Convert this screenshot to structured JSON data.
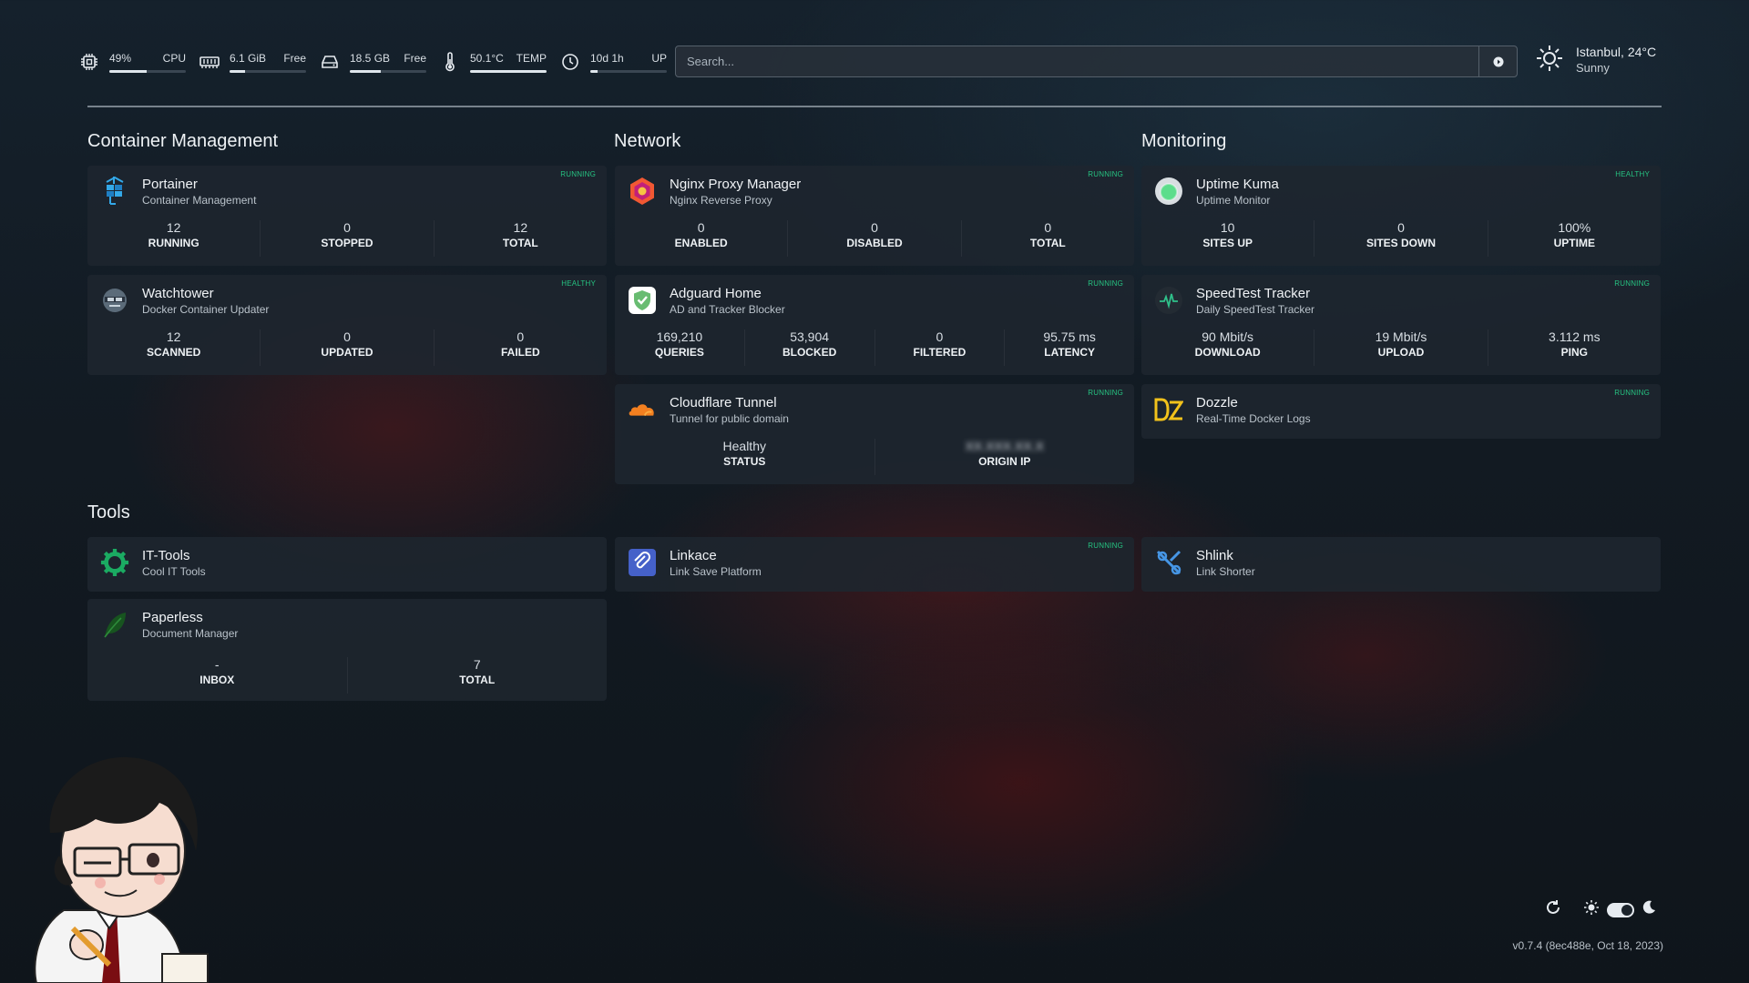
{
  "topbar": {
    "cpu": {
      "value": "49%",
      "label": "CPU",
      "fill": 0.49
    },
    "ram": {
      "value": "6.1 GiB",
      "label": "Free",
      "fill": 0.2
    },
    "disk": {
      "value": "18.5 GB",
      "label": "Free",
      "fill": 0.4
    },
    "temp": {
      "value": "50.1°C",
      "label": "TEMP",
      "fill": 1.0
    },
    "uptime": {
      "value": "10d 1h",
      "label": "UP",
      "fill": 0.1
    },
    "search_placeholder": "Search...",
    "weather": {
      "location": "Istanbul, 24°C",
      "condition": "Sunny"
    }
  },
  "sections": {
    "container": "Container Management",
    "network": "Network",
    "monitoring": "Monitoring",
    "tools": "Tools"
  },
  "cards": {
    "portainer": {
      "title": "Portainer",
      "subtitle": "Container Management",
      "badge": "RUNNING",
      "stats": [
        {
          "value": "12",
          "label": "RUNNING"
        },
        {
          "value": "0",
          "label": "STOPPED"
        },
        {
          "value": "12",
          "label": "TOTAL"
        }
      ]
    },
    "watchtower": {
      "title": "Watchtower",
      "subtitle": "Docker Container Updater",
      "badge": "HEALTHY",
      "stats": [
        {
          "value": "12",
          "label": "SCANNED"
        },
        {
          "value": "0",
          "label": "UPDATED"
        },
        {
          "value": "0",
          "label": "FAILED"
        }
      ]
    },
    "nginx": {
      "title": "Nginx Proxy Manager",
      "subtitle": "Nginx Reverse Proxy",
      "badge": "RUNNING",
      "stats": [
        {
          "value": "0",
          "label": "ENABLED"
        },
        {
          "value": "0",
          "label": "DISABLED"
        },
        {
          "value": "0",
          "label": "TOTAL"
        }
      ]
    },
    "adguard": {
      "title": "Adguard Home",
      "subtitle": "AD and Tracker Blocker",
      "badge": "RUNNING",
      "stats": [
        {
          "value": "169,210",
          "label": "QUERIES"
        },
        {
          "value": "53,904",
          "label": "BLOCKED"
        },
        {
          "value": "0",
          "label": "FILTERED"
        },
        {
          "value": "95.75 ms",
          "label": "LATENCY"
        }
      ]
    },
    "cloudflare": {
      "title": "Cloudflare Tunnel",
      "subtitle": "Tunnel for public domain",
      "badge": "RUNNING",
      "stats": [
        {
          "value": "Healthy",
          "label": "STATUS"
        },
        {
          "value": "XX.XXX.XX.X",
          "label": "ORIGIN IP"
        }
      ]
    },
    "uptimekuma": {
      "title": "Uptime Kuma",
      "subtitle": "Uptime Monitor",
      "badge": "HEALTHY",
      "stats": [
        {
          "value": "10",
          "label": "SITES UP"
        },
        {
          "value": "0",
          "label": "SITES DOWN"
        },
        {
          "value": "100%",
          "label": "UPTIME"
        }
      ]
    },
    "speedtest": {
      "title": "SpeedTest Tracker",
      "subtitle": "Daily SpeedTest Tracker",
      "badge": "RUNNING",
      "stats": [
        {
          "value": "90 Mbit/s",
          "label": "DOWNLOAD"
        },
        {
          "value": "19 Mbit/s",
          "label": "UPLOAD"
        },
        {
          "value": "3.112 ms",
          "label": "PING"
        }
      ]
    },
    "dozzle": {
      "title": "Dozzle",
      "subtitle": "Real-Time Docker Logs",
      "badge": "RUNNING"
    },
    "ittools": {
      "title": "IT-Tools",
      "subtitle": "Cool IT Tools"
    },
    "linkace": {
      "title": "Linkace",
      "subtitle": "Link Save Platform",
      "badge": "RUNNING"
    },
    "shlink": {
      "title": "Shlink",
      "subtitle": "Link Shorter"
    },
    "paperless": {
      "title": "Paperless",
      "subtitle": "Document Manager",
      "stats": [
        {
          "value": "-",
          "label": "INBOX"
        },
        {
          "value": "7",
          "label": "TOTAL"
        }
      ]
    }
  },
  "footer": {
    "version": "v0.7.4 (8ec488e, Oct 18, 2023)"
  },
  "colors": {
    "accent_green": "#26c281",
    "background": "#121a22",
    "card": "#1e262f"
  }
}
